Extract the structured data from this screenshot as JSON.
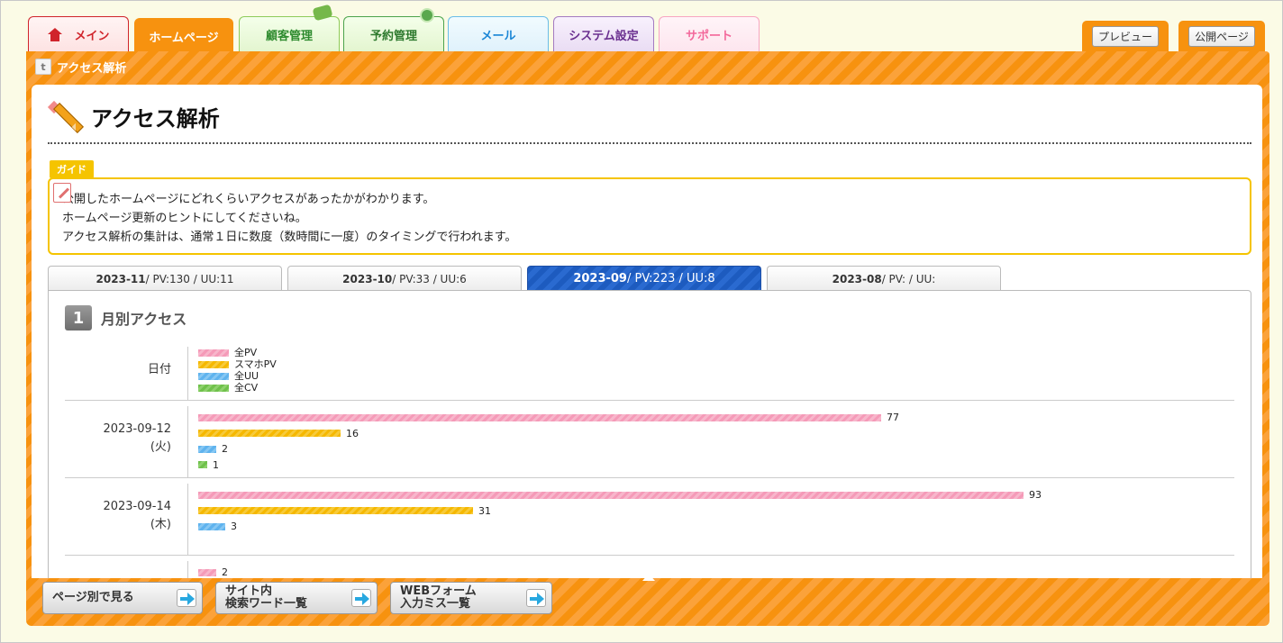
{
  "tabs": {
    "main": "メイン",
    "home": "ホームページ",
    "customer": "顧客管理",
    "reservation": "予約管理",
    "mail": "メール",
    "system": "システム設定",
    "support": "サポート"
  },
  "top_buttons": {
    "preview": "プレビュー",
    "public": "公開ページ"
  },
  "panel": {
    "header": "アクセス解析"
  },
  "page": {
    "title": "アクセス解析"
  },
  "guide": {
    "tag": "ガイド",
    "lines": [
      "公開したホームページにどれくらいアクセスがあったかがわかります。",
      "ホームページ更新のヒントにしてくださいね。",
      "アクセス解析の集計は、通常１日に数度（数時間に一度）のタイミングで行われます。"
    ]
  },
  "month_tabs": [
    {
      "month": "2023-11",
      "stats": "/ PV:130 / UU:11",
      "active": false
    },
    {
      "month": "2023-10",
      "stats": "/ PV:33 / UU:6",
      "active": false
    },
    {
      "month": "2023-09",
      "stats": "/ PV:223 / UU:8",
      "active": true
    },
    {
      "month": "2023-08",
      "stats": "/ PV: / UU:",
      "active": false
    }
  ],
  "section": {
    "number": "1",
    "title": "月別アクセス"
  },
  "table": {
    "date_header": "日付",
    "legend": [
      "全PV",
      "スマホPV",
      "全UU",
      "全CV"
    ]
  },
  "colors": {
    "pv": "#f59ab8",
    "spv": "#f5b800",
    "uu": "#5fb3ee",
    "cv": "#6fc14b",
    "accent": "#f7920f",
    "active_tab": "#1d5bbf"
  },
  "chart_data": {
    "type": "bar",
    "title": "月別アクセス",
    "rows": [
      {
        "date": "2023-09-12",
        "weekday": "(火)",
        "pv": 77,
        "spv": 16,
        "uu": 2,
        "cv": 1
      },
      {
        "date": "2023-09-14",
        "weekday": "(木)",
        "pv": 93,
        "spv": 31,
        "uu": 3,
        "cv": null
      },
      {
        "date": "",
        "weekday": "",
        "pv": 2,
        "spv": null,
        "uu": null,
        "cv": null
      }
    ],
    "max_value": 93
  },
  "bottom_buttons": [
    {
      "label": "ページ別で見る"
    },
    {
      "label": "サイト内\n検索ワード一覧"
    },
    {
      "label": "WEBフォーム\n入力ミス一覧"
    }
  ]
}
